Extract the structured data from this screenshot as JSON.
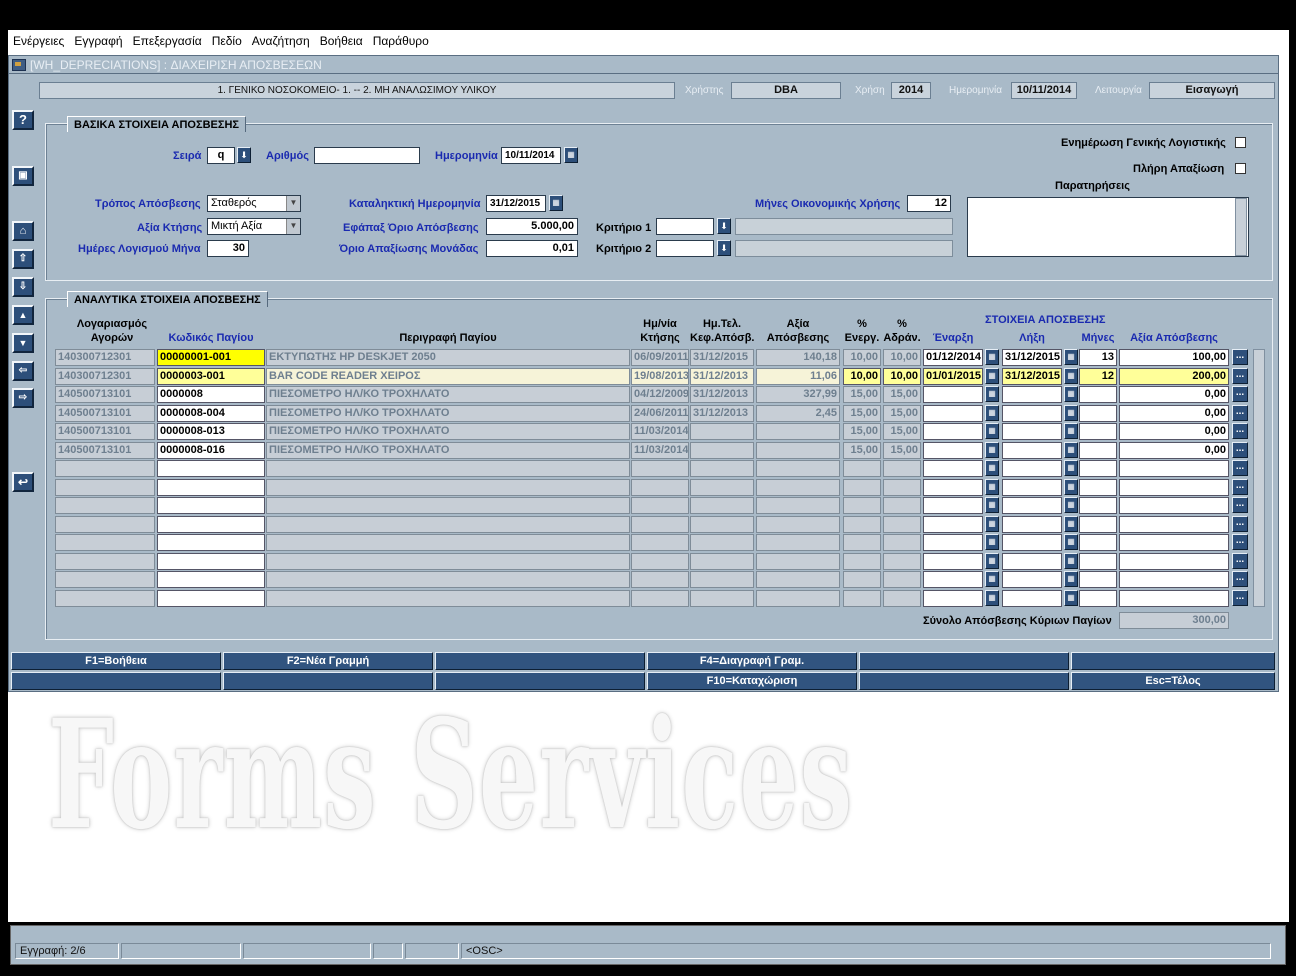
{
  "menu": [
    "Ενέργειες",
    "Εγγραφή",
    "Επεξεργασία",
    "Πεδίο",
    "Αναζήτηση",
    "Βοήθεια",
    "Παράθυρο"
  ],
  "window": {
    "title": "[WH_DEPRECIATIONS]  :  ΔΙΑΧΕΙΡΙΣΗ ΑΠΟΣΒΕΣΕΩΝ"
  },
  "header": {
    "org": "1. ΓΕΝΙΚΟ ΝΟΣΟΚΟΜΕΙΟ- 1. -- 2. ΜΗ ΑΝΑΛΩΣΙΜΟΥ ΥΛΙΚΟΥ",
    "user_label": "Χρήστης",
    "user": "DBA",
    "year_label": "Χρήση",
    "year": "2014",
    "date_label": "Ημερομηνία",
    "date": "10/11/2014",
    "mode_label": "Λειτουργία",
    "mode": "Εισαγωγή"
  },
  "basic": {
    "title": "ΒΑΣΙΚΑ ΣΤΟΙΧΕΙΑ ΑΠΟΣΒΕΣΗΣ",
    "series_label": "Σειρά",
    "series": "q",
    "number_label": "Αριθμός",
    "number": "",
    "date_label": "Ημερομηνία",
    "date": "10/11/2014",
    "method_label": "Τρόπος Απόσβεσης",
    "method": "Σταθερός",
    "acq_value_label": "Αξία Κτήσης",
    "acq_value": "Μικτή Αξία",
    "days_label": "Ημέρες Λογισμού Μήνα",
    "days": "30",
    "end_date_label": "Καταληκτική Ημερομηνία",
    "end_date": "31/12/2015",
    "once_limit_label": "Εφάπαξ Όριο Απόσβεσης",
    "once_limit": "5.000,00",
    "unit_limit_label": "Όριο Απαξίωσης Μονάδας",
    "unit_limit": "0,01",
    "crit1_label": "Κριτήριο 1",
    "crit1": "",
    "crit2_label": "Κριτήριο 2",
    "crit2": "",
    "months_label": "Μήνες Οικονομικής Χρήσης",
    "months": "12",
    "gl_update_label": "Ενημέρωση Γενικής Λογιστικής",
    "full_depr_label": "Πλήρη Απαξίωση",
    "notes_label": "Παρατηρήσεις",
    "notes": ""
  },
  "details": {
    "title": "ΑΝΑΛΥΤΙΚΑ ΣΤΟΙΧΕΙΑ ΑΠΟΣΒΕΣΗΣ",
    "group_label": "ΣΤΟΙΧΕΙΑ ΑΠΟΣΒΕΣΗΣ",
    "headers": {
      "account": "Λογαριασμός",
      "account2": "Αγορών",
      "code": "Κωδικός Παγίου",
      "desc": "Περιγραφή Παγίου",
      "acq_date": "Ημ/νία",
      "acq_date2": "Κτήσης",
      "end_date": "Ημ.Τελ.",
      "end_date2": "Κεφ.Απόσβ.",
      "value": "Αξία",
      "value2": "Απόσβεσης",
      "pct_active": "%",
      "pct_active2": "Ενεργ.",
      "pct_idle": "%",
      "pct_idle2": "Αδράν.",
      "start": "Έναρξη",
      "stop": "Λήξη",
      "months": "Μήνες",
      "amount": "Αξία Απόσβεσης"
    },
    "rows": [
      {
        "account": "140300712301",
        "code": "00000001-001",
        "desc": "ΕΚΤΥΠΩΤΗΣ HP DESKJET 2050",
        "acq_date": "06/09/2011",
        "end_date": "31/12/2015",
        "value": "140,18",
        "pct_active": "10,00",
        "pct_idle": "10,00",
        "start": "01/12/2014",
        "stop": "31/12/2015",
        "months": "13",
        "amount": "100,00"
      },
      {
        "account": "140300712301",
        "code": "0000003-001",
        "desc": "BAR CODE READER ΧΕΙΡΟΣ",
        "acq_date": "19/08/2013",
        "end_date": "31/12/2013",
        "value": "11,06",
        "pct_active": "10,00",
        "pct_idle": "10,00",
        "start": "01/01/2015",
        "stop": "31/12/2015",
        "months": "12",
        "amount": "200,00"
      },
      {
        "account": "140500713101",
        "code": "0000008",
        "desc": "ΠΙΕΣΟΜΕΤΡΟ ΗΛ/ΚΟ ΤΡΟΧΗΛΑΤΟ",
        "acq_date": "04/12/2009",
        "end_date": "31/12/2013",
        "value": "327,99",
        "pct_active": "15,00",
        "pct_idle": "15,00",
        "start": "",
        "stop": "",
        "months": "",
        "amount": "0,00"
      },
      {
        "account": "140500713101",
        "code": "0000008-004",
        "desc": "ΠΙΕΣΟΜΕΤΡΟ ΗΛ/ΚΟ ΤΡΟΧΗΛΑΤΟ",
        "acq_date": "24/06/2011",
        "end_date": "31/12/2013",
        "value": "2,45",
        "pct_active": "15,00",
        "pct_idle": "15,00",
        "start": "",
        "stop": "",
        "months": "",
        "amount": "0,00"
      },
      {
        "account": "140500713101",
        "code": "0000008-013",
        "desc": "ΠΙΕΣΟΜΕΤΡΟ ΗΛ/ΚΟ ΤΡΟΧΗΛΑΤΟ",
        "acq_date": "11/03/2014",
        "end_date": "",
        "value": "",
        "pct_active": "15,00",
        "pct_idle": "15,00",
        "start": "",
        "stop": "",
        "months": "",
        "amount": "0,00"
      },
      {
        "account": "140500713101",
        "code": "0000008-016",
        "desc": "ΠΙΕΣΟΜΕΤΡΟ ΗΛ/ΚΟ ΤΡΟΧΗΛΑΤΟ",
        "acq_date": "11/03/2014",
        "end_date": "",
        "value": "",
        "pct_active": "15,00",
        "pct_idle": "15,00",
        "start": "",
        "stop": "",
        "months": "",
        "amount": "0,00"
      },
      {
        "account": "",
        "code": "",
        "desc": "",
        "acq_date": "",
        "end_date": "",
        "value": "",
        "pct_active": "",
        "pct_idle": "",
        "start": "",
        "stop": "",
        "months": "",
        "amount": ""
      },
      {
        "account": "",
        "code": "",
        "desc": "",
        "acq_date": "",
        "end_date": "",
        "value": "",
        "pct_active": "",
        "pct_idle": "",
        "start": "",
        "stop": "",
        "months": "",
        "amount": ""
      },
      {
        "account": "",
        "code": "",
        "desc": "",
        "acq_date": "",
        "end_date": "",
        "value": "",
        "pct_active": "",
        "pct_idle": "",
        "start": "",
        "stop": "",
        "months": "",
        "amount": ""
      },
      {
        "account": "",
        "code": "",
        "desc": "",
        "acq_date": "",
        "end_date": "",
        "value": "",
        "pct_active": "",
        "pct_idle": "",
        "start": "",
        "stop": "",
        "months": "",
        "amount": ""
      },
      {
        "account": "",
        "code": "",
        "desc": "",
        "acq_date": "",
        "end_date": "",
        "value": "",
        "pct_active": "",
        "pct_idle": "",
        "start": "",
        "stop": "",
        "months": "",
        "amount": ""
      },
      {
        "account": "",
        "code": "",
        "desc": "",
        "acq_date": "",
        "end_date": "",
        "value": "",
        "pct_active": "",
        "pct_idle": "",
        "start": "",
        "stop": "",
        "months": "",
        "amount": ""
      },
      {
        "account": "",
        "code": "",
        "desc": "",
        "acq_date": "",
        "end_date": "",
        "value": "",
        "pct_active": "",
        "pct_idle": "",
        "start": "",
        "stop": "",
        "months": "",
        "amount": ""
      },
      {
        "account": "",
        "code": "",
        "desc": "",
        "acq_date": "",
        "end_date": "",
        "value": "",
        "pct_active": "",
        "pct_idle": "",
        "start": "",
        "stop": "",
        "months": "",
        "amount": ""
      }
    ],
    "total_label": "Σύνολο Απόσβεσης Κύριων Παγίων",
    "total": "300,00"
  },
  "fkeys": {
    "f1": "F1=Βοήθεια",
    "f2": "F2=Νέα Γραμμή",
    "f4": "F4=Διαγραφή Γραμ.",
    "f10": "F10=Καταχώριση",
    "esc": "Esc=Τέλος"
  },
  "watermark": "Forms Services",
  "status": {
    "record": "Εγγραφή: 2/6",
    "osc": "<OSC>"
  },
  "sidebar_icons": [
    "help-icon",
    "save-icon",
    "delete-icon",
    "first-record-icon",
    "last-record-icon",
    "prev-record-icon",
    "next-record-icon",
    "prev-block-icon",
    "next-block-icon",
    "exit-icon"
  ]
}
